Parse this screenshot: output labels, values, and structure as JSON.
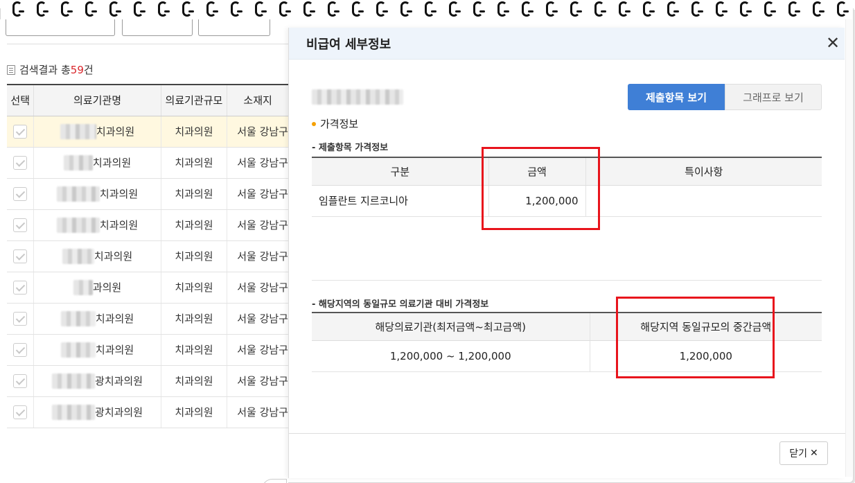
{
  "left_panel": {
    "count_prefix": "검색결과 총",
    "count_value": "59",
    "count_suffix": "건",
    "columns": [
      "선택",
      "의료기관명",
      "의료기관규모",
      "소재지"
    ],
    "rows": [
      {
        "name": "치과의원",
        "scale": "치과의원",
        "location": "서울 강남구",
        "selected": true
      },
      {
        "name": "치과의원",
        "scale": "치과의원",
        "location": "서울 강남구",
        "selected": false
      },
      {
        "name": "치과의원",
        "scale": "치과의원",
        "location": "서울 강남구",
        "selected": false
      },
      {
        "name": "치과의원",
        "scale": "치과의원",
        "location": "서울 강남구",
        "selected": false
      },
      {
        "name": "치과의원",
        "scale": "치과의원",
        "location": "서울 강남구",
        "selected": false
      },
      {
        "name": "과의원",
        "scale": "치과의원",
        "location": "서울 강남구",
        "selected": false
      },
      {
        "name": "치과의원",
        "scale": "치과의원",
        "location": "서울 강남구",
        "selected": false
      },
      {
        "name": "치과의원",
        "scale": "치과의원",
        "location": "서울 강남구",
        "selected": false
      },
      {
        "name": "광치과의원",
        "scale": "치과의원",
        "location": "서울 강남구",
        "selected": false
      },
      {
        "name": "광치과의원",
        "scale": "치과의원",
        "location": "서울 강남구",
        "selected": false
      }
    ],
    "collapse_glyph": "«"
  },
  "modal": {
    "title": "비급여 세부정보",
    "close_glyph": "✕",
    "tabs": [
      {
        "label": "제출항목 보기",
        "active": true
      },
      {
        "label": "그래프로 보기",
        "active": false
      }
    ],
    "section_title": "가격정보",
    "submitted": {
      "subtitle": "- 제출항목 가격정보",
      "columns": [
        "구분",
        "금액",
        "특이사항"
      ],
      "rows": [
        {
          "item": "임플란트 지르코니아",
          "amount": "1,200,000",
          "note": ""
        }
      ]
    },
    "regional": {
      "subtitle": "- 해당지역의 동일규모 의료기관 대비 가격정보",
      "columns": [
        "해당의료기관(최저금액~최고금액)",
        "해당지역 동일규모의 중간금액"
      ],
      "rows": [
        {
          "range": "1,200,000 ~ 1,200,000",
          "median": "1,200,000"
        }
      ]
    },
    "close_button_label": "닫기",
    "close_button_glyph": "✕"
  },
  "colors": {
    "accent_blue": "#3f7fd6",
    "highlight_red": "#e8141c",
    "count_red": "#d9262b",
    "bullet_orange": "#f5a000",
    "header_bg": "#eef4fb"
  }
}
